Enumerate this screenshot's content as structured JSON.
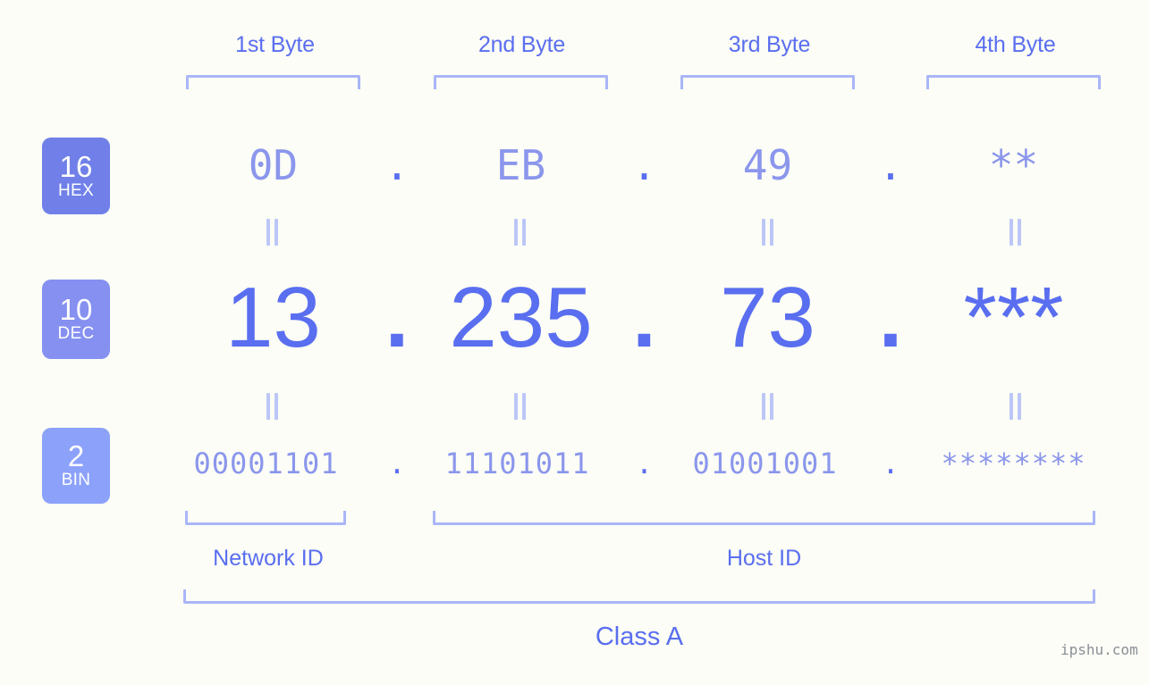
{
  "meta": {
    "background_color": "#fbfdf6",
    "accent_color": "#5a6ef0",
    "light_accent_color": "#8b96ec",
    "bracket_color": "#aab6f7",
    "watermark": "ipshu.com"
  },
  "headers": {
    "bytes": [
      {
        "label": "1st Byte"
      },
      {
        "label": "2nd Byte"
      },
      {
        "label": "3rd Byte"
      },
      {
        "label": "4th Byte"
      }
    ]
  },
  "radix_badges": [
    {
      "base": "16",
      "name": "HEX",
      "color": "#7080e8"
    },
    {
      "base": "10",
      "name": "DEC",
      "color": "#8590f0"
    },
    {
      "base": "2",
      "name": "BIN",
      "color": "#8ba1fa"
    }
  ],
  "rows": {
    "hex": {
      "values": [
        "0D",
        "EB",
        "49",
        "**"
      ],
      "separator": "."
    },
    "dec": {
      "values": [
        "13",
        "235",
        "73",
        "***"
      ],
      "separator": "."
    },
    "bin": {
      "values": [
        "00001101",
        "11101011",
        "01001001",
        "********"
      ],
      "separator": "."
    }
  },
  "id_sections": [
    {
      "label": "Network ID"
    },
    {
      "label": "Host ID"
    }
  ],
  "class": {
    "label": "Class A"
  }
}
